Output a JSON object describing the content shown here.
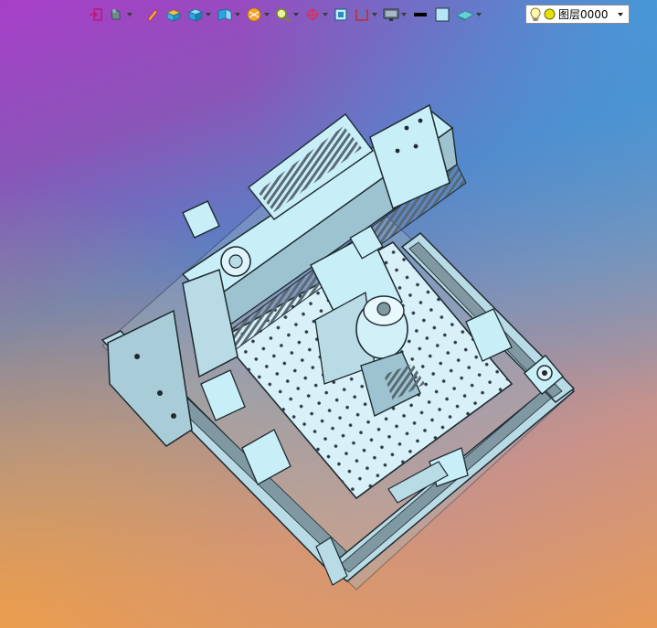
{
  "toolbar": {
    "items": [
      {
        "name": "exit-sketch-icon",
        "has_dropdown": false
      },
      {
        "name": "display-mode-icon",
        "has_dropdown": true
      },
      {
        "name": "pencil-icon",
        "has_dropdown": false
      },
      {
        "name": "box-section-icon",
        "has_dropdown": false
      },
      {
        "name": "cube-view-icon",
        "has_dropdown": true
      },
      {
        "name": "view-orientation-icon",
        "has_dropdown": true
      },
      {
        "name": "render-style-icon",
        "has_dropdown": true
      },
      {
        "name": "zoom-icon",
        "has_dropdown": true
      },
      {
        "name": "pan-rotate-icon",
        "has_dropdown": true
      },
      {
        "name": "fit-view-icon",
        "has_dropdown": false
      },
      {
        "name": "section-plane-icon",
        "has_dropdown": true
      },
      {
        "name": "monitor-display-icon",
        "has_dropdown": true
      },
      {
        "name": "line-color-icon",
        "has_dropdown": false
      },
      {
        "name": "fill-color-icon",
        "has_dropdown": false
      },
      {
        "name": "surface-style-icon",
        "has_dropdown": true
      }
    ],
    "line_color": "#000000",
    "fill_color": "#b8e4f8"
  },
  "layer_selector": {
    "value": "图层0000",
    "bulb_icon": "lightbulb-icon",
    "status_icon": "layer-status-icon",
    "status_color": "#e8e000"
  },
  "viewport": {
    "gradient_colors": [
      "#a73fc8",
      "#5b7fc4",
      "#3aa0dc",
      "#c8928a",
      "#e79a58"
    ],
    "model_color": "#c8eef8"
  }
}
